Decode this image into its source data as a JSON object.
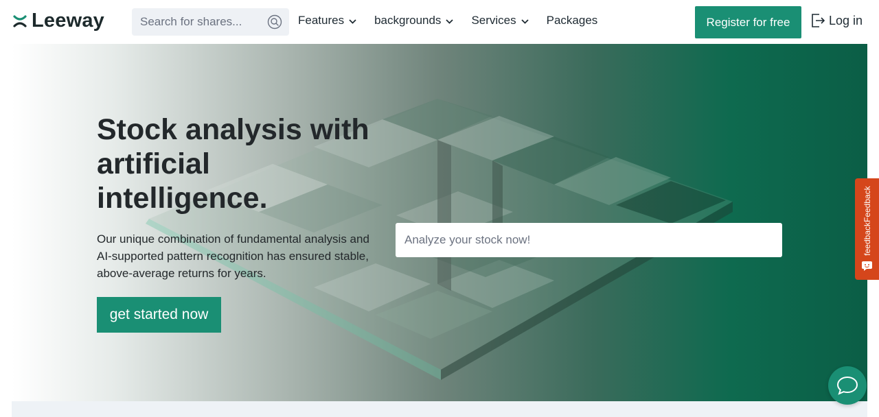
{
  "header": {
    "logo_text": "Leeway",
    "search": {
      "placeholder": "Search for shares..."
    },
    "nav": [
      {
        "label": "Features"
      },
      {
        "label": "backgrounds"
      },
      {
        "label": "Services"
      },
      {
        "label": "Packages"
      }
    ],
    "register_label": "Register for free",
    "login_label": "Log in"
  },
  "hero": {
    "title": "Stock analysis with artificial intelligence.",
    "subtitle": "Our unique combination of fundamental analysis and AI-supported pattern recognition has ensured stable, above-average returns for years.",
    "cta_label": "get started now",
    "analyze_placeholder": "Analyze your stock now!"
  },
  "feedback": {
    "label": "feedbackFeedback"
  },
  "colors": {
    "brand": "#1a8f74",
    "feedback": "#d5461b",
    "text": "#23282b"
  }
}
